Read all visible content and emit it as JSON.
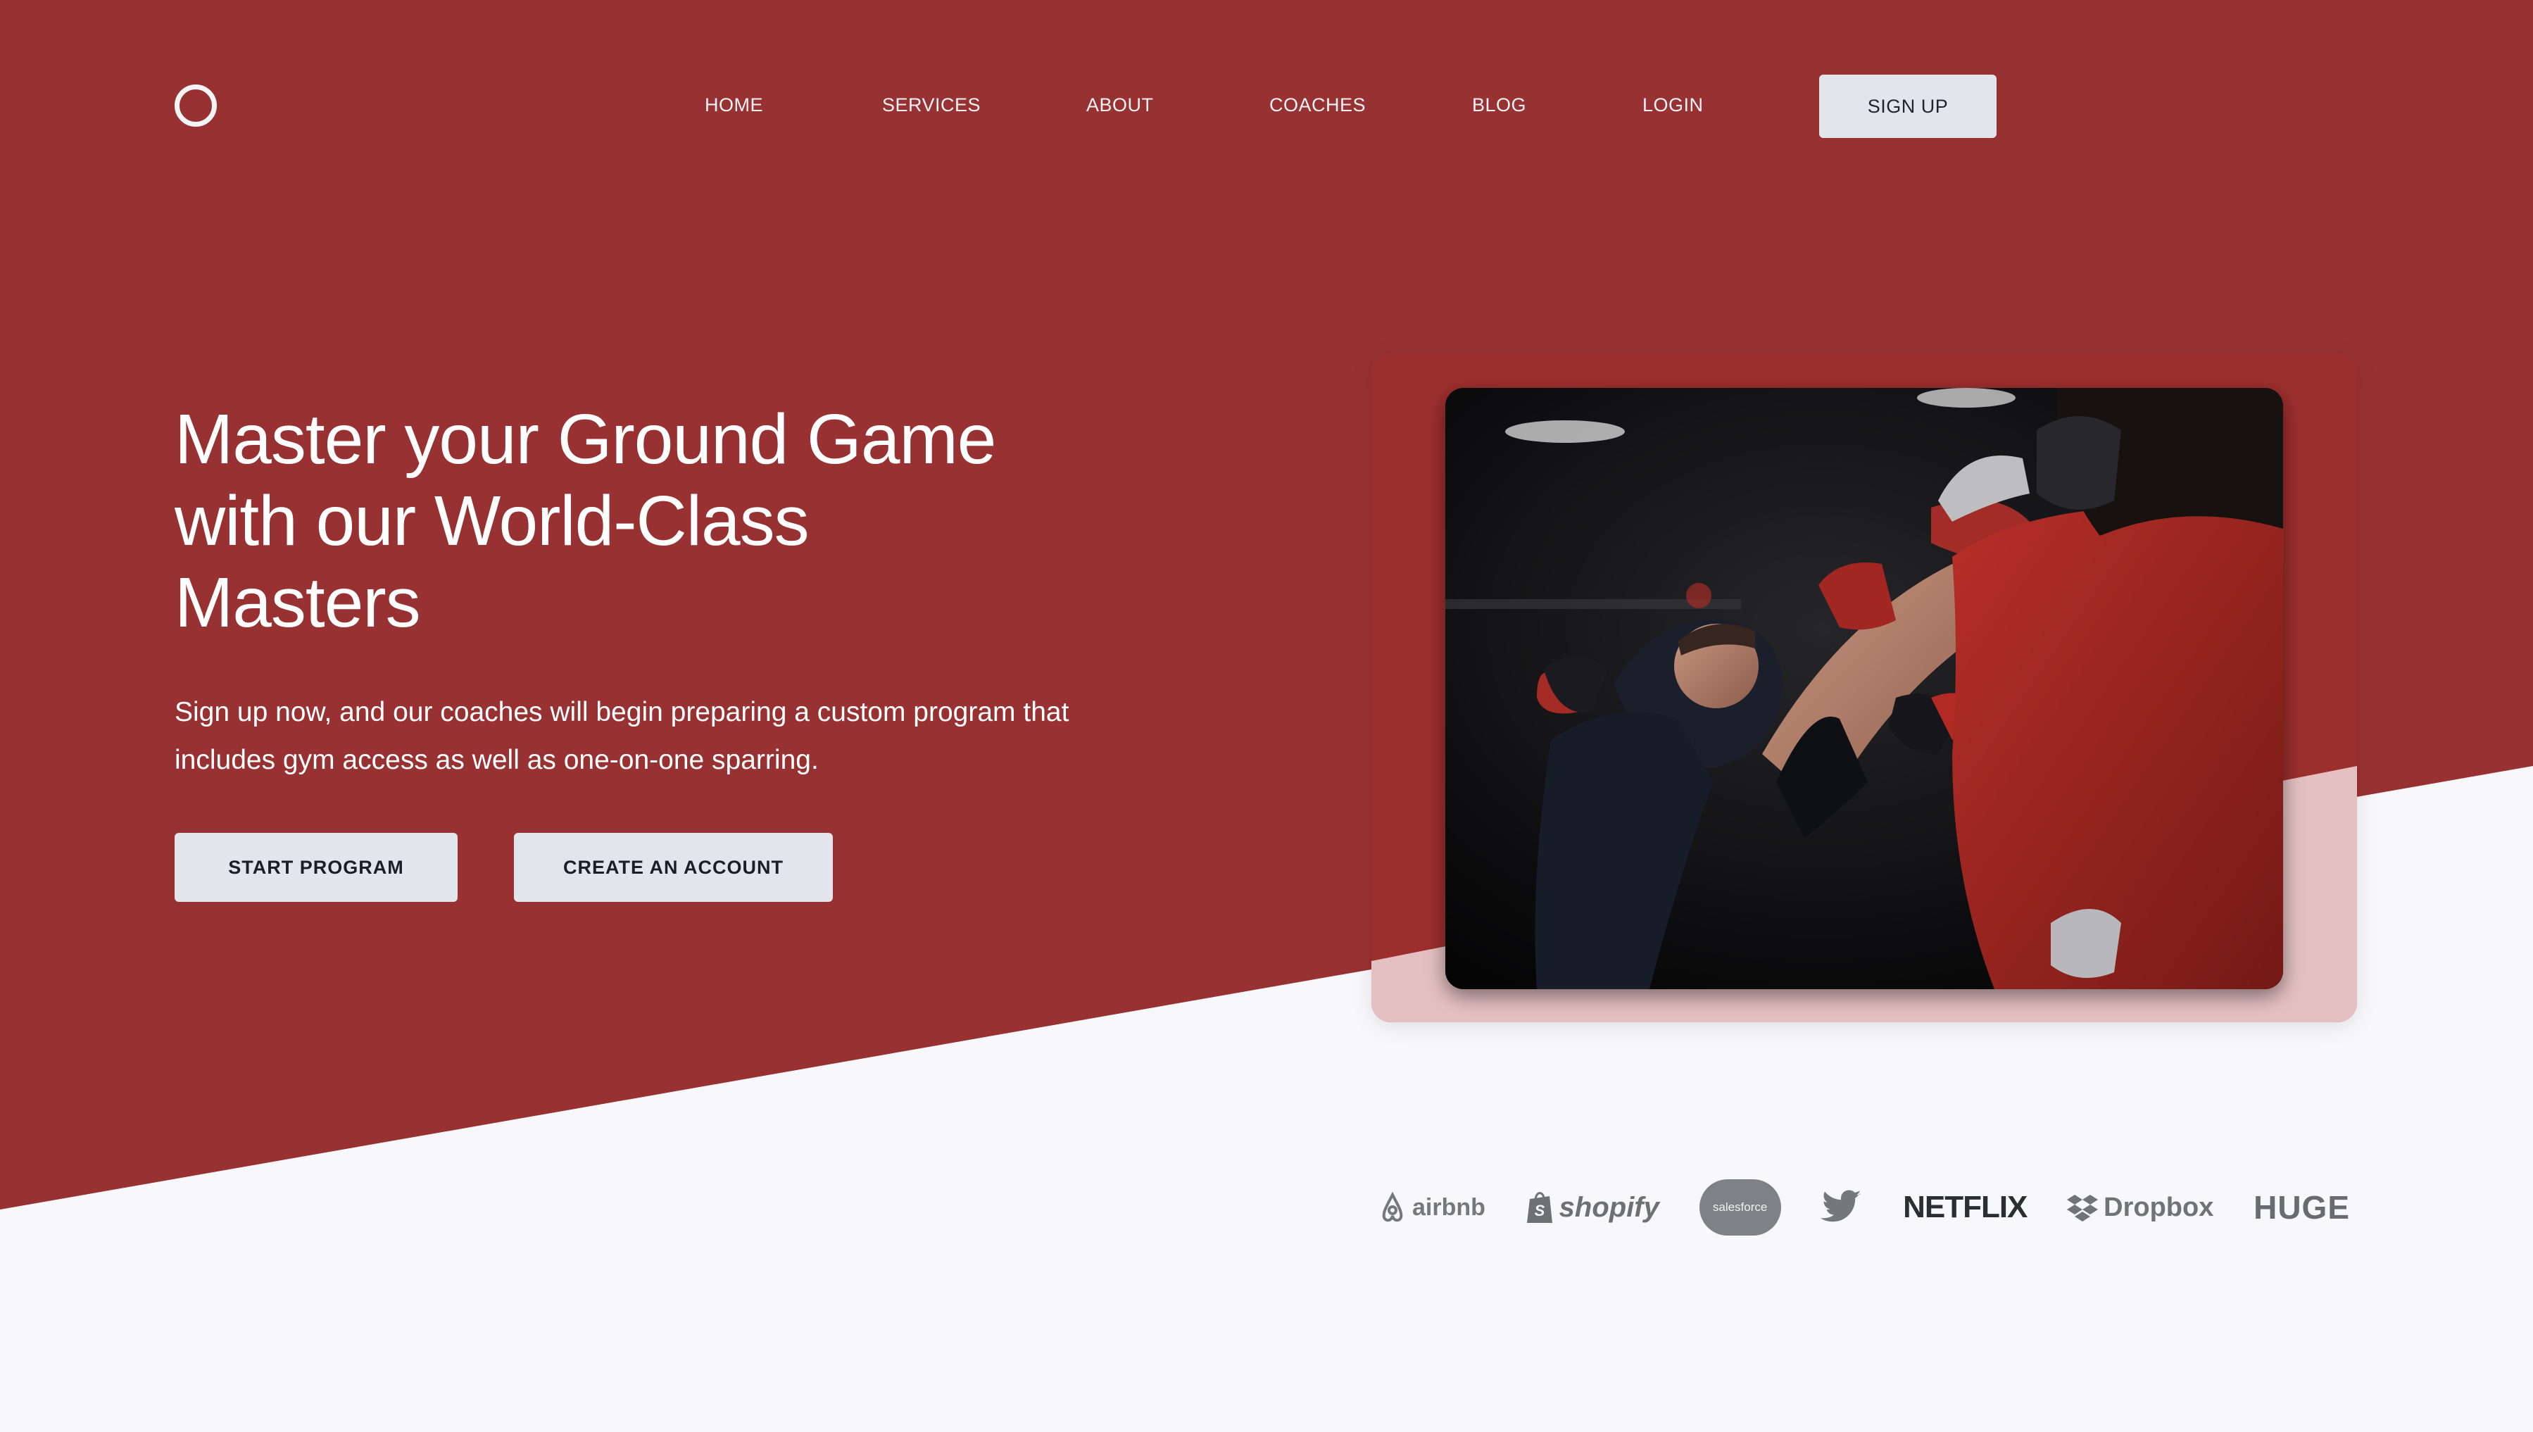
{
  "colors": {
    "hero_background": "#983131",
    "page_background": "#f8f8fb",
    "button_background": "#e3e5ec",
    "card_accent": "#e4c0c1"
  },
  "header": {
    "logo_icon": "circle-logo-icon",
    "nav": [
      "HOME",
      "SERVICES",
      "ABOUT",
      "COACHES",
      "BLOG",
      "LOGIN"
    ],
    "signup_label": "SIGN UP"
  },
  "hero": {
    "headline_lines": [
      "Master your Ground Game",
      "with our World-Class",
      "Masters"
    ],
    "subtext_lines": [
      "Sign up now, and our coaches will begin preparing a custom program that",
      "includes gym access as well as one-on-one sparring."
    ],
    "primary_button": "START PROGRAM",
    "secondary_button": "CREATE AN ACCOUNT"
  },
  "partners": {
    "airbnb": "airbnb",
    "shopify": "shopify",
    "salesforce": "salesforce",
    "twitter_icon": "twitter-bird-icon",
    "netflix": "NETFLIX",
    "dropbox": "Dropbox",
    "huge": "HUGE"
  }
}
